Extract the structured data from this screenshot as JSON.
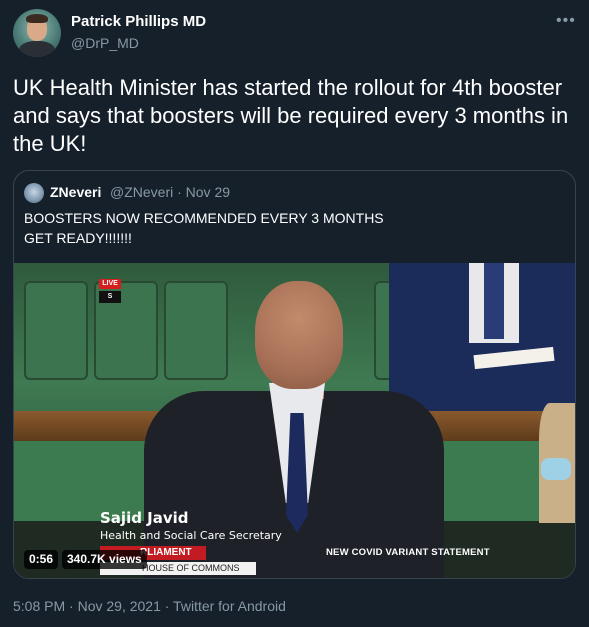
{
  "author": {
    "name": "Patrick Phillips MD",
    "handle": "@DrP_MD"
  },
  "more_icon": "more-horizontal-icon",
  "tweet": {
    "text": "UK Health Minister has started the rollout for 4th booster and says that boosters will be required every 3 months in the UK!"
  },
  "quoted": {
    "name": "ZNeveri",
    "meta": "@ZNeveri · Nov 29",
    "line1": "BOOSTERS NOW RECOMMENDED EVERY 3 MONTHS",
    "line2": "GET READY!!!!!!!",
    "video": {
      "live_label": "LIVE",
      "live_sub": "S",
      "caption_name": "Sajid Javid",
      "caption_role": "Health and Social Care Secretary",
      "strip_text": "RLIAMENT",
      "house_text": "HOUSE OF COMMONS",
      "statement": "NEW COVID VARIANT STATEMENT",
      "duration": "0:56",
      "views": "340.7K views"
    }
  },
  "footer": {
    "text": "5:08 PM · Nov 29, 2021 · Twitter for Android"
  },
  "colors": {
    "background": "#15202b",
    "secondary_text": "#8899a6",
    "border": "#38444d"
  }
}
